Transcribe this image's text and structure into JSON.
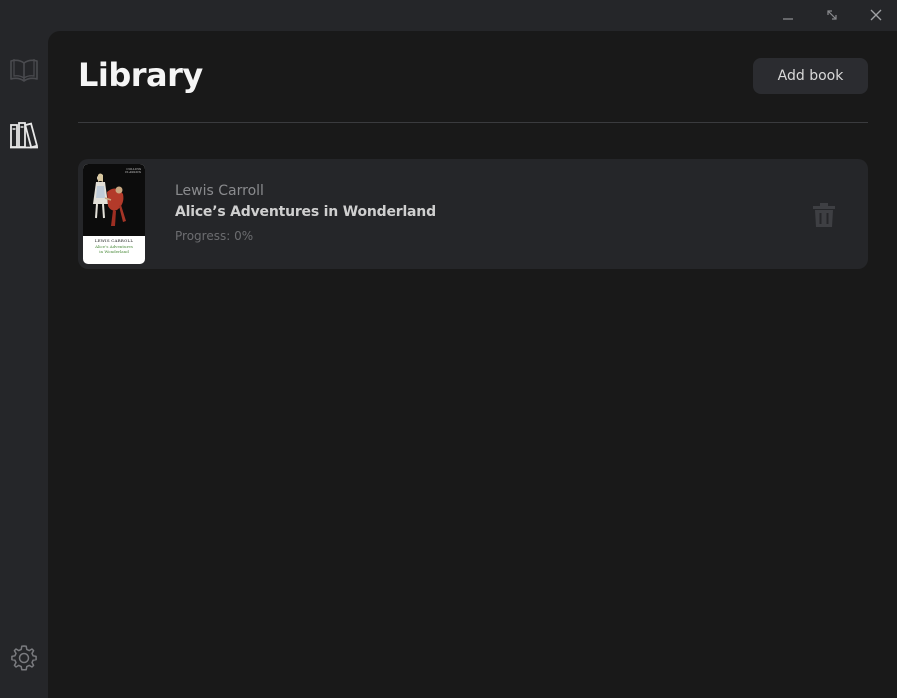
{
  "window": {
    "controls": {
      "minimize_icon": "minimize-icon",
      "maximize_icon": "maximize-icon",
      "close_icon": "close-icon"
    }
  },
  "sidebar": {
    "items": [
      {
        "id": "reader",
        "icon": "open-book-icon",
        "active": false
      },
      {
        "id": "library",
        "icon": "bookshelf-icon",
        "active": true
      },
      {
        "id": "settings",
        "icon": "gear-icon",
        "active": false
      }
    ]
  },
  "main": {
    "title": "Library",
    "add_button_label": "Add book"
  },
  "books": [
    {
      "author": "Lewis Carroll",
      "title": "Alice’s Adventures in Wonderland",
      "progress": "Progress: 0%",
      "cover": {
        "publisher_line1": "COLLINS",
        "publisher_line2": "CLASSICS",
        "author": "LEWIS CARROLL",
        "title_line1": "Alice’s Adventures",
        "title_line2": "in Wonderland"
      },
      "delete_icon": "trash-icon"
    }
  ],
  "colors": {
    "background": "#252629",
    "panel": "#191919",
    "card": "#252629",
    "accent_text": "#f5f5f5",
    "muted_text": "#8a8b8e"
  }
}
